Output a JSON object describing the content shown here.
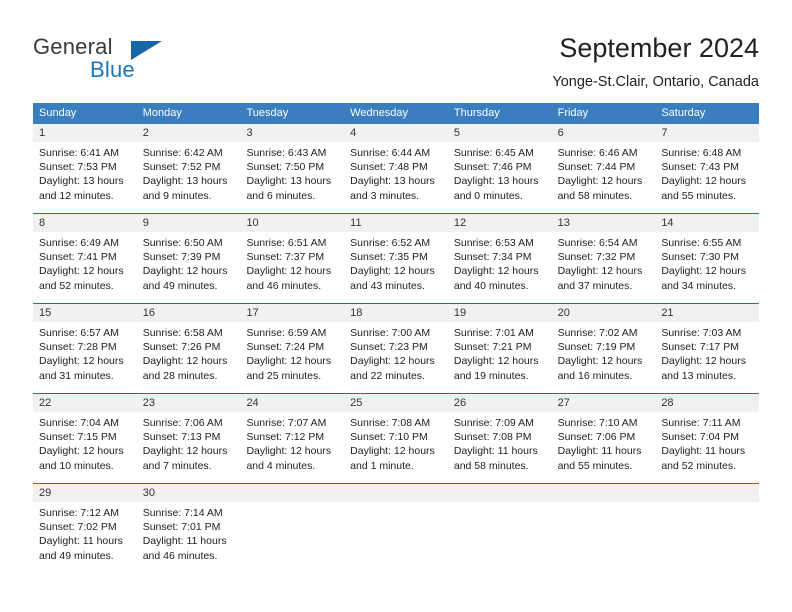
{
  "brand": {
    "name_part1": "General",
    "name_part2": "Blue",
    "accent_color": "#1565a8"
  },
  "header": {
    "title": "September 2024",
    "location": "Yonge-St.Clair, Ontario, Canada"
  },
  "theme": {
    "header_row_bg": "#3a7ec0",
    "week_divider": "#1f6cb0",
    "daynum_band_bg": "#f1f1f1"
  },
  "weekdays": [
    "Sunday",
    "Monday",
    "Tuesday",
    "Wednesday",
    "Thursday",
    "Friday",
    "Saturday"
  ],
  "weeks": [
    {
      "days": [
        {
          "num": "1",
          "sunrise": "Sunrise: 6:41 AM",
          "sunset": "Sunset: 7:53 PM",
          "daylight1": "Daylight: 13 hours",
          "daylight2": "and 12 minutes."
        },
        {
          "num": "2",
          "sunrise": "Sunrise: 6:42 AM",
          "sunset": "Sunset: 7:52 PM",
          "daylight1": "Daylight: 13 hours",
          "daylight2": "and 9 minutes."
        },
        {
          "num": "3",
          "sunrise": "Sunrise: 6:43 AM",
          "sunset": "Sunset: 7:50 PM",
          "daylight1": "Daylight: 13 hours",
          "daylight2": "and 6 minutes."
        },
        {
          "num": "4",
          "sunrise": "Sunrise: 6:44 AM",
          "sunset": "Sunset: 7:48 PM",
          "daylight1": "Daylight: 13 hours",
          "daylight2": "and 3 minutes."
        },
        {
          "num": "5",
          "sunrise": "Sunrise: 6:45 AM",
          "sunset": "Sunset: 7:46 PM",
          "daylight1": "Daylight: 13 hours",
          "daylight2": "and 0 minutes."
        },
        {
          "num": "6",
          "sunrise": "Sunrise: 6:46 AM",
          "sunset": "Sunset: 7:44 PM",
          "daylight1": "Daylight: 12 hours",
          "daylight2": "and 58 minutes."
        },
        {
          "num": "7",
          "sunrise": "Sunrise: 6:48 AM",
          "sunset": "Sunset: 7:43 PM",
          "daylight1": "Daylight: 12 hours",
          "daylight2": "and 55 minutes."
        }
      ]
    },
    {
      "days": [
        {
          "num": "8",
          "sunrise": "Sunrise: 6:49 AM",
          "sunset": "Sunset: 7:41 PM",
          "daylight1": "Daylight: 12 hours",
          "daylight2": "and 52 minutes."
        },
        {
          "num": "9",
          "sunrise": "Sunrise: 6:50 AM",
          "sunset": "Sunset: 7:39 PM",
          "daylight1": "Daylight: 12 hours",
          "daylight2": "and 49 minutes."
        },
        {
          "num": "10",
          "sunrise": "Sunrise: 6:51 AM",
          "sunset": "Sunset: 7:37 PM",
          "daylight1": "Daylight: 12 hours",
          "daylight2": "and 46 minutes."
        },
        {
          "num": "11",
          "sunrise": "Sunrise: 6:52 AM",
          "sunset": "Sunset: 7:35 PM",
          "daylight1": "Daylight: 12 hours",
          "daylight2": "and 43 minutes."
        },
        {
          "num": "12",
          "sunrise": "Sunrise: 6:53 AM",
          "sunset": "Sunset: 7:34 PM",
          "daylight1": "Daylight: 12 hours",
          "daylight2": "and 40 minutes."
        },
        {
          "num": "13",
          "sunrise": "Sunrise: 6:54 AM",
          "sunset": "Sunset: 7:32 PM",
          "daylight1": "Daylight: 12 hours",
          "daylight2": "and 37 minutes."
        },
        {
          "num": "14",
          "sunrise": "Sunrise: 6:55 AM",
          "sunset": "Sunset: 7:30 PM",
          "daylight1": "Daylight: 12 hours",
          "daylight2": "and 34 minutes."
        }
      ]
    },
    {
      "days": [
        {
          "num": "15",
          "sunrise": "Sunrise: 6:57 AM",
          "sunset": "Sunset: 7:28 PM",
          "daylight1": "Daylight: 12 hours",
          "daylight2": "and 31 minutes."
        },
        {
          "num": "16",
          "sunrise": "Sunrise: 6:58 AM",
          "sunset": "Sunset: 7:26 PM",
          "daylight1": "Daylight: 12 hours",
          "daylight2": "and 28 minutes."
        },
        {
          "num": "17",
          "sunrise": "Sunrise: 6:59 AM",
          "sunset": "Sunset: 7:24 PM",
          "daylight1": "Daylight: 12 hours",
          "daylight2": "and 25 minutes."
        },
        {
          "num": "18",
          "sunrise": "Sunrise: 7:00 AM",
          "sunset": "Sunset: 7:23 PM",
          "daylight1": "Daylight: 12 hours",
          "daylight2": "and 22 minutes."
        },
        {
          "num": "19",
          "sunrise": "Sunrise: 7:01 AM",
          "sunset": "Sunset: 7:21 PM",
          "daylight1": "Daylight: 12 hours",
          "daylight2": "and 19 minutes."
        },
        {
          "num": "20",
          "sunrise": "Sunrise: 7:02 AM",
          "sunset": "Sunset: 7:19 PM",
          "daylight1": "Daylight: 12 hours",
          "daylight2": "and 16 minutes."
        },
        {
          "num": "21",
          "sunrise": "Sunrise: 7:03 AM",
          "sunset": "Sunset: 7:17 PM",
          "daylight1": "Daylight: 12 hours",
          "daylight2": "and 13 minutes."
        }
      ]
    },
    {
      "days": [
        {
          "num": "22",
          "sunrise": "Sunrise: 7:04 AM",
          "sunset": "Sunset: 7:15 PM",
          "daylight1": "Daylight: 12 hours",
          "daylight2": "and 10 minutes."
        },
        {
          "num": "23",
          "sunrise": "Sunrise: 7:06 AM",
          "sunset": "Sunset: 7:13 PM",
          "daylight1": "Daylight: 12 hours",
          "daylight2": "and 7 minutes."
        },
        {
          "num": "24",
          "sunrise": "Sunrise: 7:07 AM",
          "sunset": "Sunset: 7:12 PM",
          "daylight1": "Daylight: 12 hours",
          "daylight2": "and 4 minutes."
        },
        {
          "num": "25",
          "sunrise": "Sunrise: 7:08 AM",
          "sunset": "Sunset: 7:10 PM",
          "daylight1": "Daylight: 12 hours",
          "daylight2": "and 1 minute."
        },
        {
          "num": "26",
          "sunrise": "Sunrise: 7:09 AM",
          "sunset": "Sunset: 7:08 PM",
          "daylight1": "Daylight: 11 hours",
          "daylight2": "and 58 minutes."
        },
        {
          "num": "27",
          "sunrise": "Sunrise: 7:10 AM",
          "sunset": "Sunset: 7:06 PM",
          "daylight1": "Daylight: 11 hours",
          "daylight2": "and 55 minutes."
        },
        {
          "num": "28",
          "sunrise": "Sunrise: 7:11 AM",
          "sunset": "Sunset: 7:04 PM",
          "daylight1": "Daylight: 11 hours",
          "daylight2": "and 52 minutes."
        }
      ]
    },
    {
      "days": [
        {
          "num": "29",
          "sunrise": "Sunrise: 7:12 AM",
          "sunset": "Sunset: 7:02 PM",
          "daylight1": "Daylight: 11 hours",
          "daylight2": "and 49 minutes."
        },
        {
          "num": "30",
          "sunrise": "Sunrise: 7:14 AM",
          "sunset": "Sunset: 7:01 PM",
          "daylight1": "Daylight: 11 hours",
          "daylight2": "and 46 minutes."
        },
        {
          "num": "",
          "sunrise": "",
          "sunset": "",
          "daylight1": "",
          "daylight2": ""
        },
        {
          "num": "",
          "sunrise": "",
          "sunset": "",
          "daylight1": "",
          "daylight2": ""
        },
        {
          "num": "",
          "sunrise": "",
          "sunset": "",
          "daylight1": "",
          "daylight2": ""
        },
        {
          "num": "",
          "sunrise": "",
          "sunset": "",
          "daylight1": "",
          "daylight2": ""
        },
        {
          "num": "",
          "sunrise": "",
          "sunset": "",
          "daylight1": "",
          "daylight2": ""
        }
      ]
    }
  ]
}
